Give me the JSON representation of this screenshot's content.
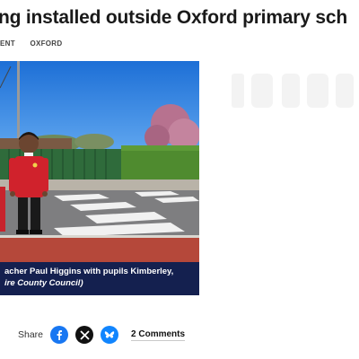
{
  "article": {
    "headline": "ng installed outside Oxford primary sch",
    "tags": [
      "ENT",
      "OXFORD"
    ],
    "image_caption_line1": "acher Paul Higgins with pupils Kimberley,",
    "image_caption_line2": "ire County Council)"
  },
  "share": {
    "label": "Share",
    "icons": [
      "facebook-icon",
      "x-icon",
      "bluesky-icon"
    ],
    "comments_label": "2 Comments"
  },
  "colors": {
    "caption_bg": "#14204f",
    "facebook": "#1877f2",
    "x": "#111111",
    "bluesky": "#1185fe"
  }
}
